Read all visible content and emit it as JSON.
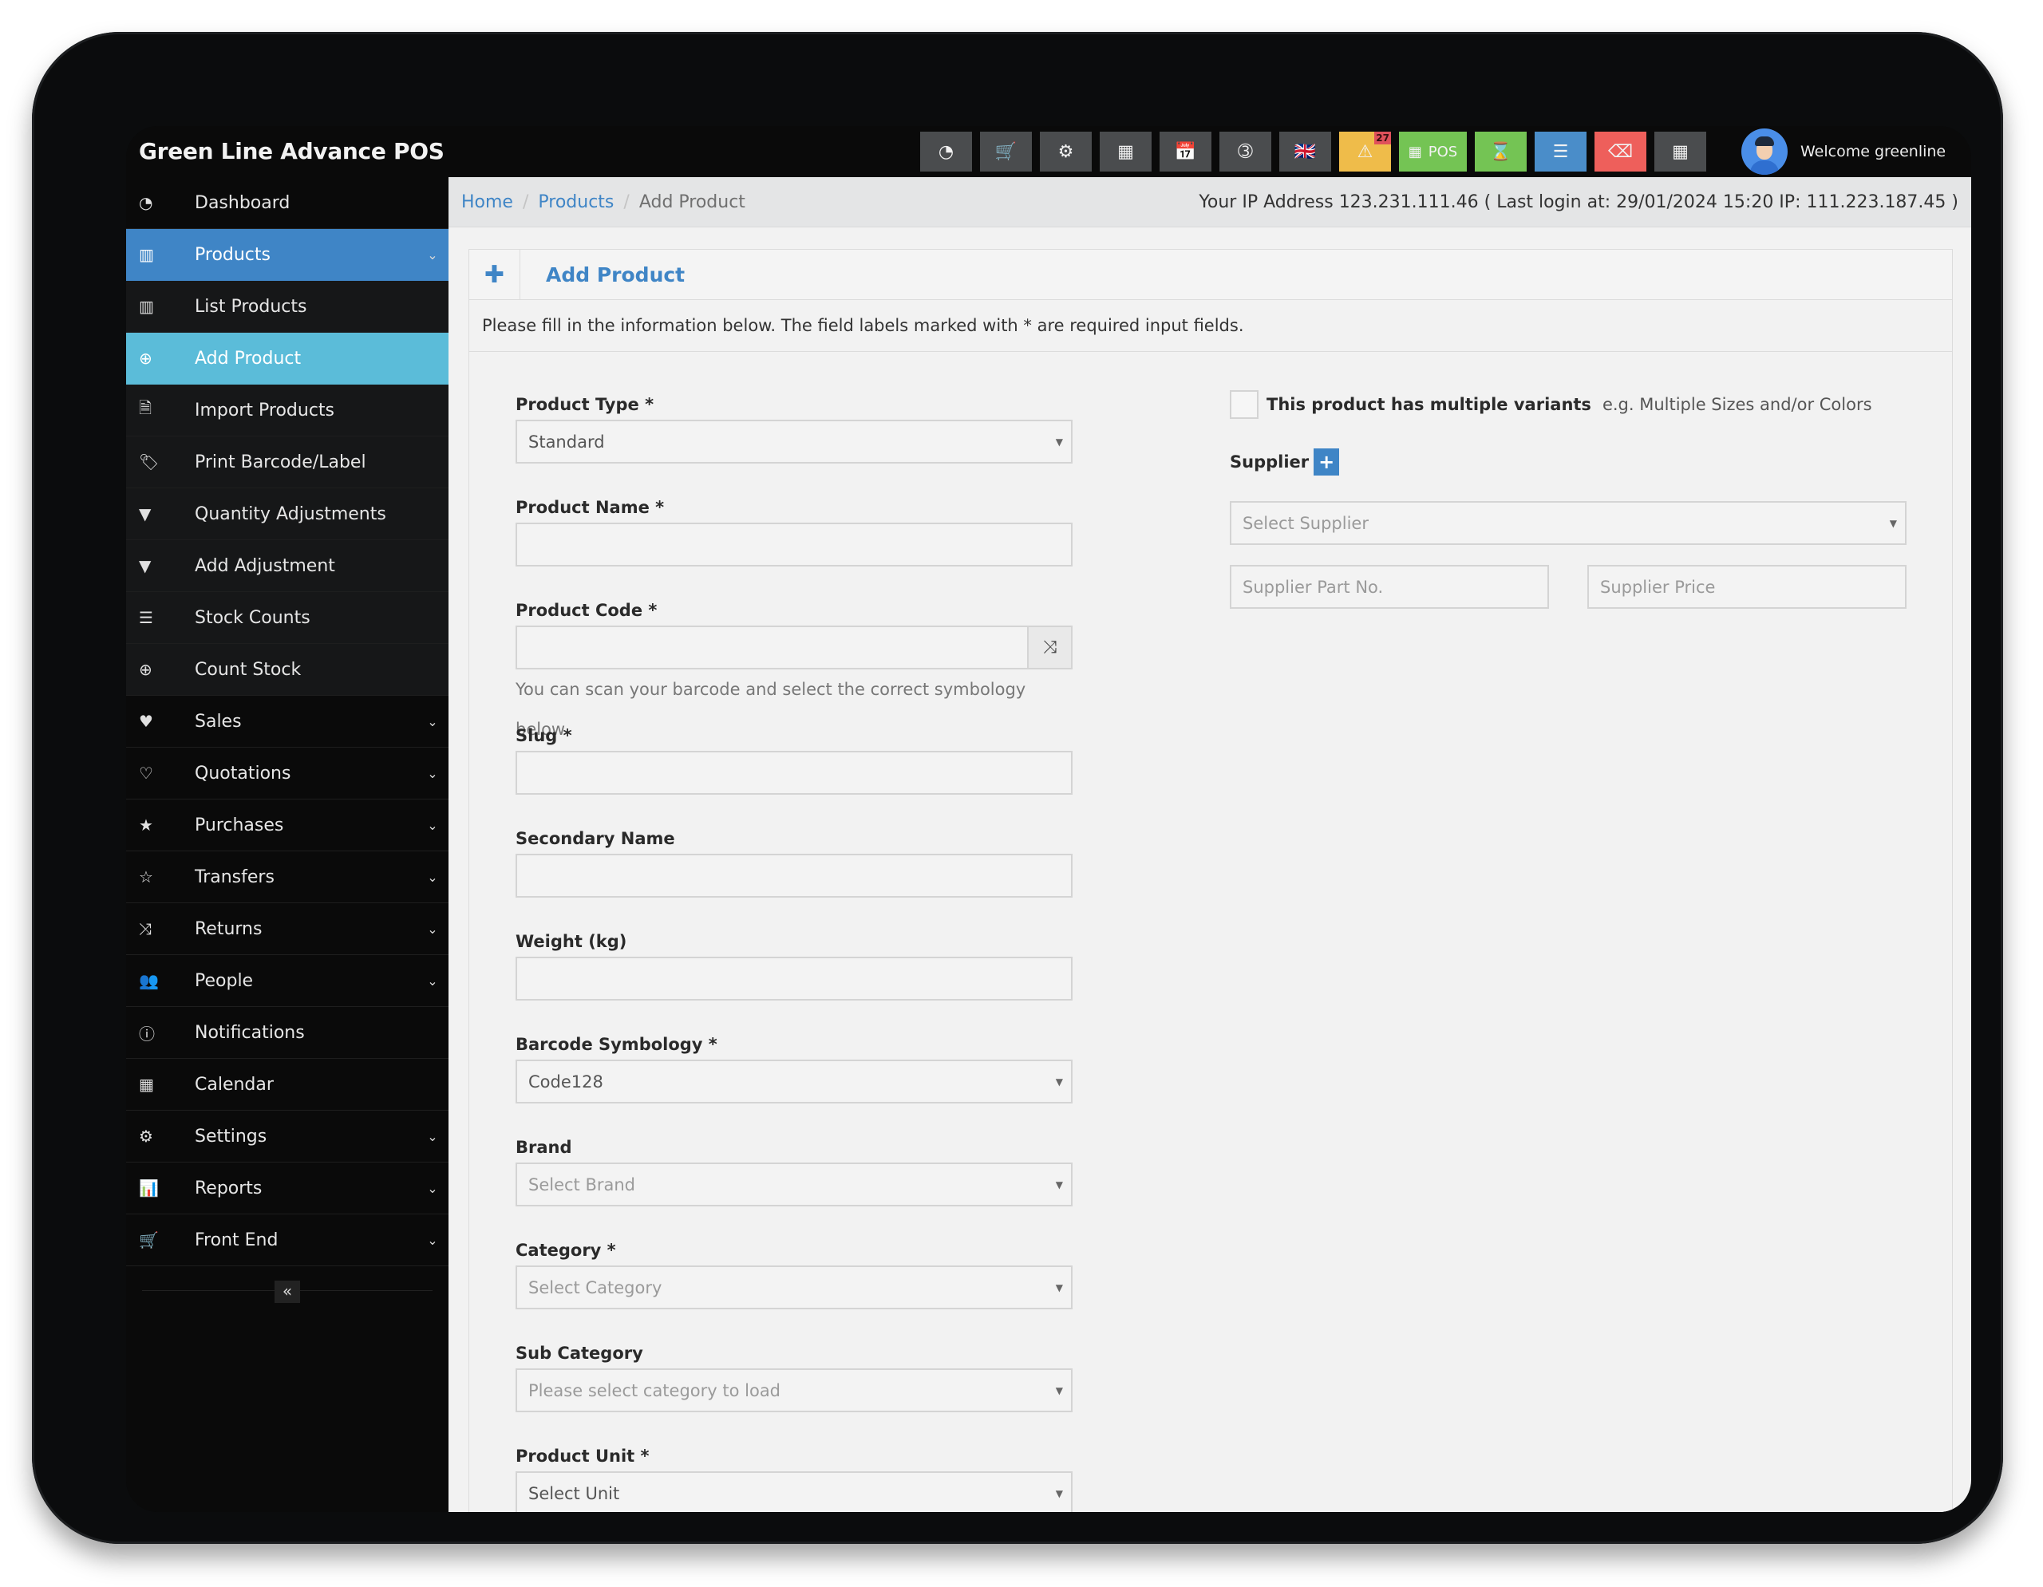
{
  "app": {
    "title": "Green Line Advance POS"
  },
  "toolbar": {
    "buttons": [
      {
        "icon": "dashboard-icon",
        "glyph": "◔"
      },
      {
        "icon": "cart-icon",
        "glyph": "🛒"
      },
      {
        "icon": "cogs-icon",
        "glyph": "⚙"
      },
      {
        "icon": "calculator-icon",
        "glyph": "▦"
      },
      {
        "icon": "calendar-icon",
        "glyph": "📅"
      },
      {
        "icon": "css3-icon",
        "glyph": "➂"
      },
      {
        "icon": "uk-flag-icon",
        "glyph": "🇬🇧"
      },
      {
        "icon": "warning-icon",
        "glyph": "⚠",
        "badge": "27"
      },
      {
        "icon": "th-large-icon",
        "glyph": "▦",
        "label": "POS"
      },
      {
        "icon": "hourglass-icon",
        "glyph": "⌛"
      },
      {
        "icon": "list-icon",
        "glyph": "☰"
      },
      {
        "icon": "eraser-icon",
        "glyph": "⌫"
      },
      {
        "icon": "grid-icon",
        "glyph": "▦"
      }
    ],
    "user": {
      "welcome": "Welcome greenline"
    }
  },
  "sidebar": {
    "items": [
      {
        "label": "Dashboard",
        "icon": "dashboard-icon",
        "glyph": "◔"
      },
      {
        "label": "Products",
        "icon": "barcode-icon",
        "glyph": "▥",
        "chevron": true,
        "state": "expanded"
      },
      {
        "label": "List Products",
        "icon": "barcode-icon",
        "glyph": "▥"
      },
      {
        "label": "Add Product",
        "icon": "plus-circle-icon",
        "glyph": "⊕",
        "state": "active"
      },
      {
        "label": "Import Products",
        "icon": "file-icon",
        "glyph": "🗎"
      },
      {
        "label": "Print Barcode/Label",
        "icon": "tags-icon",
        "glyph": "🏷"
      },
      {
        "label": "Quantity Adjustments",
        "icon": "filter-icon",
        "glyph": "▼"
      },
      {
        "label": "Add Adjustment",
        "icon": "filter-icon",
        "glyph": "▼"
      },
      {
        "label": "Stock Counts",
        "icon": "list-ol-icon",
        "glyph": "☰"
      },
      {
        "label": "Count Stock",
        "icon": "plus-circle-icon",
        "glyph": "⊕"
      },
      {
        "label": "Sales",
        "icon": "heart-icon",
        "glyph": "♥",
        "chevron": true
      },
      {
        "label": "Quotations",
        "icon": "heart-outline-icon",
        "glyph": "♡",
        "chevron": true
      },
      {
        "label": "Purchases",
        "icon": "star-icon",
        "glyph": "★",
        "chevron": true
      },
      {
        "label": "Transfers",
        "icon": "star-outline-icon",
        "glyph": "☆",
        "chevron": true
      },
      {
        "label": "Returns",
        "icon": "random-icon",
        "glyph": "⤨",
        "chevron": true
      },
      {
        "label": "People",
        "icon": "users-icon",
        "glyph": "👥",
        "chevron": true
      },
      {
        "label": "Notifications",
        "icon": "info-circle-icon",
        "glyph": "ⓘ"
      },
      {
        "label": "Calendar",
        "icon": "calendar-icon",
        "glyph": "▦"
      },
      {
        "label": "Settings",
        "icon": "cog-icon",
        "glyph": "⚙",
        "chevron": true
      },
      {
        "label": "Reports",
        "icon": "bar-chart-icon",
        "glyph": "📊",
        "chevron": true
      },
      {
        "label": "Front End",
        "icon": "cart-icon",
        "glyph": "🛒",
        "chevron": true
      }
    ],
    "collapse_glyph": "«"
  },
  "breadcrumb": {
    "items": [
      "Home",
      "Products",
      "Add Product"
    ],
    "ip_info": "Your IP Address 123.231.111.46 ( Last login at: 29/01/2024 15:20 IP: 111.223.187.45 )"
  },
  "card": {
    "title": "Add Product",
    "plus_glyph": "✚",
    "intro": "Please fill in the information below. The field labels marked with * are required input fields."
  },
  "form": {
    "product_type": {
      "label": "Product Type *",
      "value": "Standard"
    },
    "product_name": {
      "label": "Product Name *",
      "value": ""
    },
    "product_code": {
      "label": "Product Code *",
      "value": "",
      "help": "You can scan your barcode and select the correct symbology below",
      "generate_glyph": "⤨"
    },
    "slug": {
      "label": "Slug *",
      "value": ""
    },
    "secondary_name": {
      "label": "Secondary Name",
      "value": ""
    },
    "weight": {
      "label": "Weight (kg)",
      "value": ""
    },
    "barcode_symbology": {
      "label": "Barcode Symbology *",
      "value": "Code128"
    },
    "brand": {
      "label": "Brand",
      "placeholder": "Select Brand"
    },
    "category": {
      "label": "Category *",
      "placeholder": "Select Category"
    },
    "sub_category": {
      "label": "Sub Category",
      "placeholder": "Please select category to load"
    },
    "product_unit": {
      "label": "Product Unit *",
      "placeholder": "Select Unit"
    },
    "variants": {
      "label": "This product has multiple variants",
      "hint": "e.g. Multiple Sizes and/or Colors",
      "checked": false
    },
    "supplier": {
      "label": "Supplier",
      "add_glyph": "+",
      "select_placeholder": "Select Supplier",
      "part_no_placeholder": "Supplier Part No.",
      "price_placeholder": "Supplier Price"
    }
  },
  "colors": {
    "primary": "#3f85c6",
    "active_item": "#5bbcd9",
    "warning": "#efbc4a",
    "success": "#74c454",
    "danger": "#ee5f5b",
    "toolbar_gray": "#4a4c4e"
  }
}
